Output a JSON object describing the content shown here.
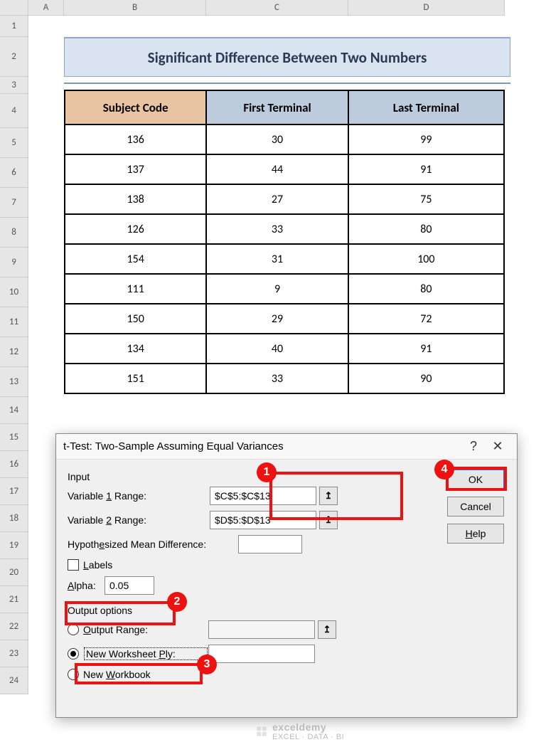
{
  "columns": {
    "A": "A",
    "B": "B",
    "C": "C",
    "D": "D"
  },
  "rows": [
    "1",
    "2",
    "3",
    "4",
    "5",
    "6",
    "7",
    "8",
    "9",
    "10",
    "11",
    "12",
    "13",
    "14",
    "15",
    "16",
    "17",
    "18",
    "19",
    "20",
    "21",
    "22",
    "23",
    "24"
  ],
  "title": "Significant Difference Between Two Numbers",
  "table": {
    "headers": {
      "code": "Subject Code",
      "first": "First Terminal",
      "last": "Last Terminal"
    },
    "rows": [
      {
        "code": "136",
        "first": "30",
        "last": "99"
      },
      {
        "code": "137",
        "first": "44",
        "last": "91"
      },
      {
        "code": "138",
        "first": "27",
        "last": "75"
      },
      {
        "code": "126",
        "first": "33",
        "last": "80"
      },
      {
        "code": "154",
        "first": "31",
        "last": "100"
      },
      {
        "code": "111",
        "first": "9",
        "last": "80"
      },
      {
        "code": "150",
        "first": "29",
        "last": "72"
      },
      {
        "code": "134",
        "first": "40",
        "last": "91"
      },
      {
        "code": "151",
        "first": "33",
        "last": "90"
      }
    ]
  },
  "dialog": {
    "title": "t-Test: Two-Sample Assuming Equal Variances",
    "help_q": "?",
    "close_x": "✕",
    "group_input": "Input",
    "var1_label_pre": "Variable ",
    "var1_label_u": "1",
    "var1_label_post": " Range:",
    "var1_value": "$C$5:$C$13",
    "var2_label_pre": "Variable ",
    "var2_label_u": "2",
    "var2_label_post": " Range:",
    "var2_value": "$D$5:$D$13",
    "hyp_label_pre": "Hypoth",
    "hyp_label_u": "e",
    "hyp_label_post": "sized Mean Difference:",
    "labels_u": "L",
    "labels_post": "abels",
    "alpha_u": "A",
    "alpha_post": "lpha:",
    "alpha_value": "0.05",
    "group_output": "Output options",
    "out_range_u": "O",
    "out_range_post": "utput Range:",
    "new_ply_pre": "New Worksheet ",
    "new_ply_u": "P",
    "new_ply_post": "ly:",
    "new_wb_pre": "New ",
    "new_wb_u": "W",
    "new_wb_post": "orkbook",
    "range_pick_glyph": "↥",
    "buttons": {
      "ok": "OK",
      "cancel": "Cancel",
      "help_u": "H",
      "help_post": "elp"
    },
    "callouts": {
      "c1": "1",
      "c2": "2",
      "c3": "3",
      "c4": "4"
    }
  },
  "watermark": {
    "brand": "exceldemy",
    "tag": "EXCEL · DATA · BI"
  },
  "chart_data": {
    "type": "table",
    "title": "Significant Difference Between Two Numbers",
    "columns": [
      "Subject Code",
      "First Terminal",
      "Last Terminal"
    ],
    "rows": [
      [
        136,
        30,
        99
      ],
      [
        137,
        44,
        91
      ],
      [
        138,
        27,
        75
      ],
      [
        126,
        33,
        80
      ],
      [
        154,
        31,
        100
      ],
      [
        111,
        9,
        80
      ],
      [
        150,
        29,
        72
      ],
      [
        134,
        40,
        91
      ],
      [
        151,
        33,
        90
      ]
    ]
  }
}
